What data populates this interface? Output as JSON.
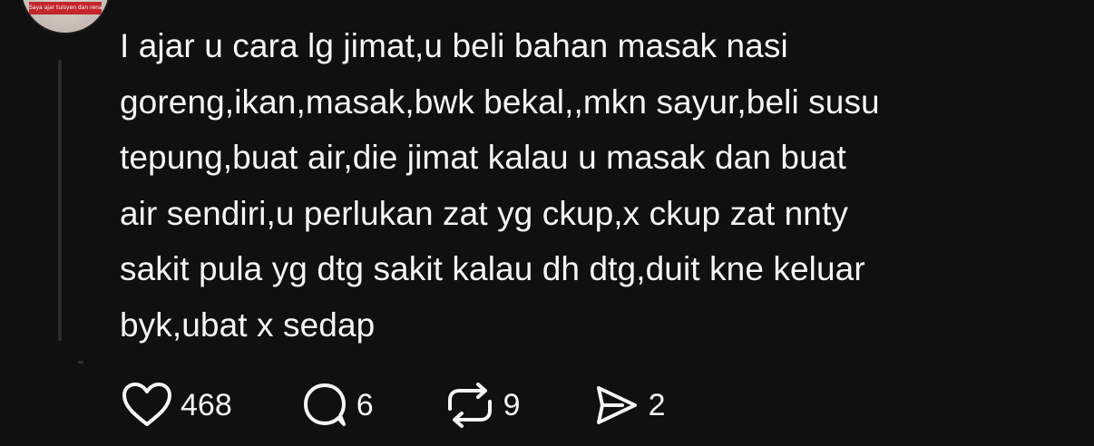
{
  "avatar": {
    "icon": "user-avatar",
    "banner_text": "Saya ajar tuisyen dan renang"
  },
  "post": {
    "lines": [
      "I ajar u cara lg jimat,u beli bahan masak nasi",
      "goreng,ikan,masak,bwk bekal,,mkn sayur,beli susu",
      "tepung,buat air,die jimat kalau u masak dan buat",
      "air sendiri,u perlukan zat yg ckup,x ckup zat nnty",
      "sakit pula yg dtg sakit kalau dh dtg,duit kne keluar",
      "byk,ubat x sedap"
    ]
  },
  "actions": {
    "like": {
      "icon": "heart-icon",
      "count": "468"
    },
    "reply": {
      "icon": "comment-icon",
      "count": "6"
    },
    "repost": {
      "icon": "repost-icon",
      "count": "9"
    },
    "share": {
      "icon": "send-icon",
      "count": "2"
    }
  },
  "colors": {
    "background": "#101010",
    "text": "#f3f5f7",
    "thread_line": "#2b2b2b"
  }
}
